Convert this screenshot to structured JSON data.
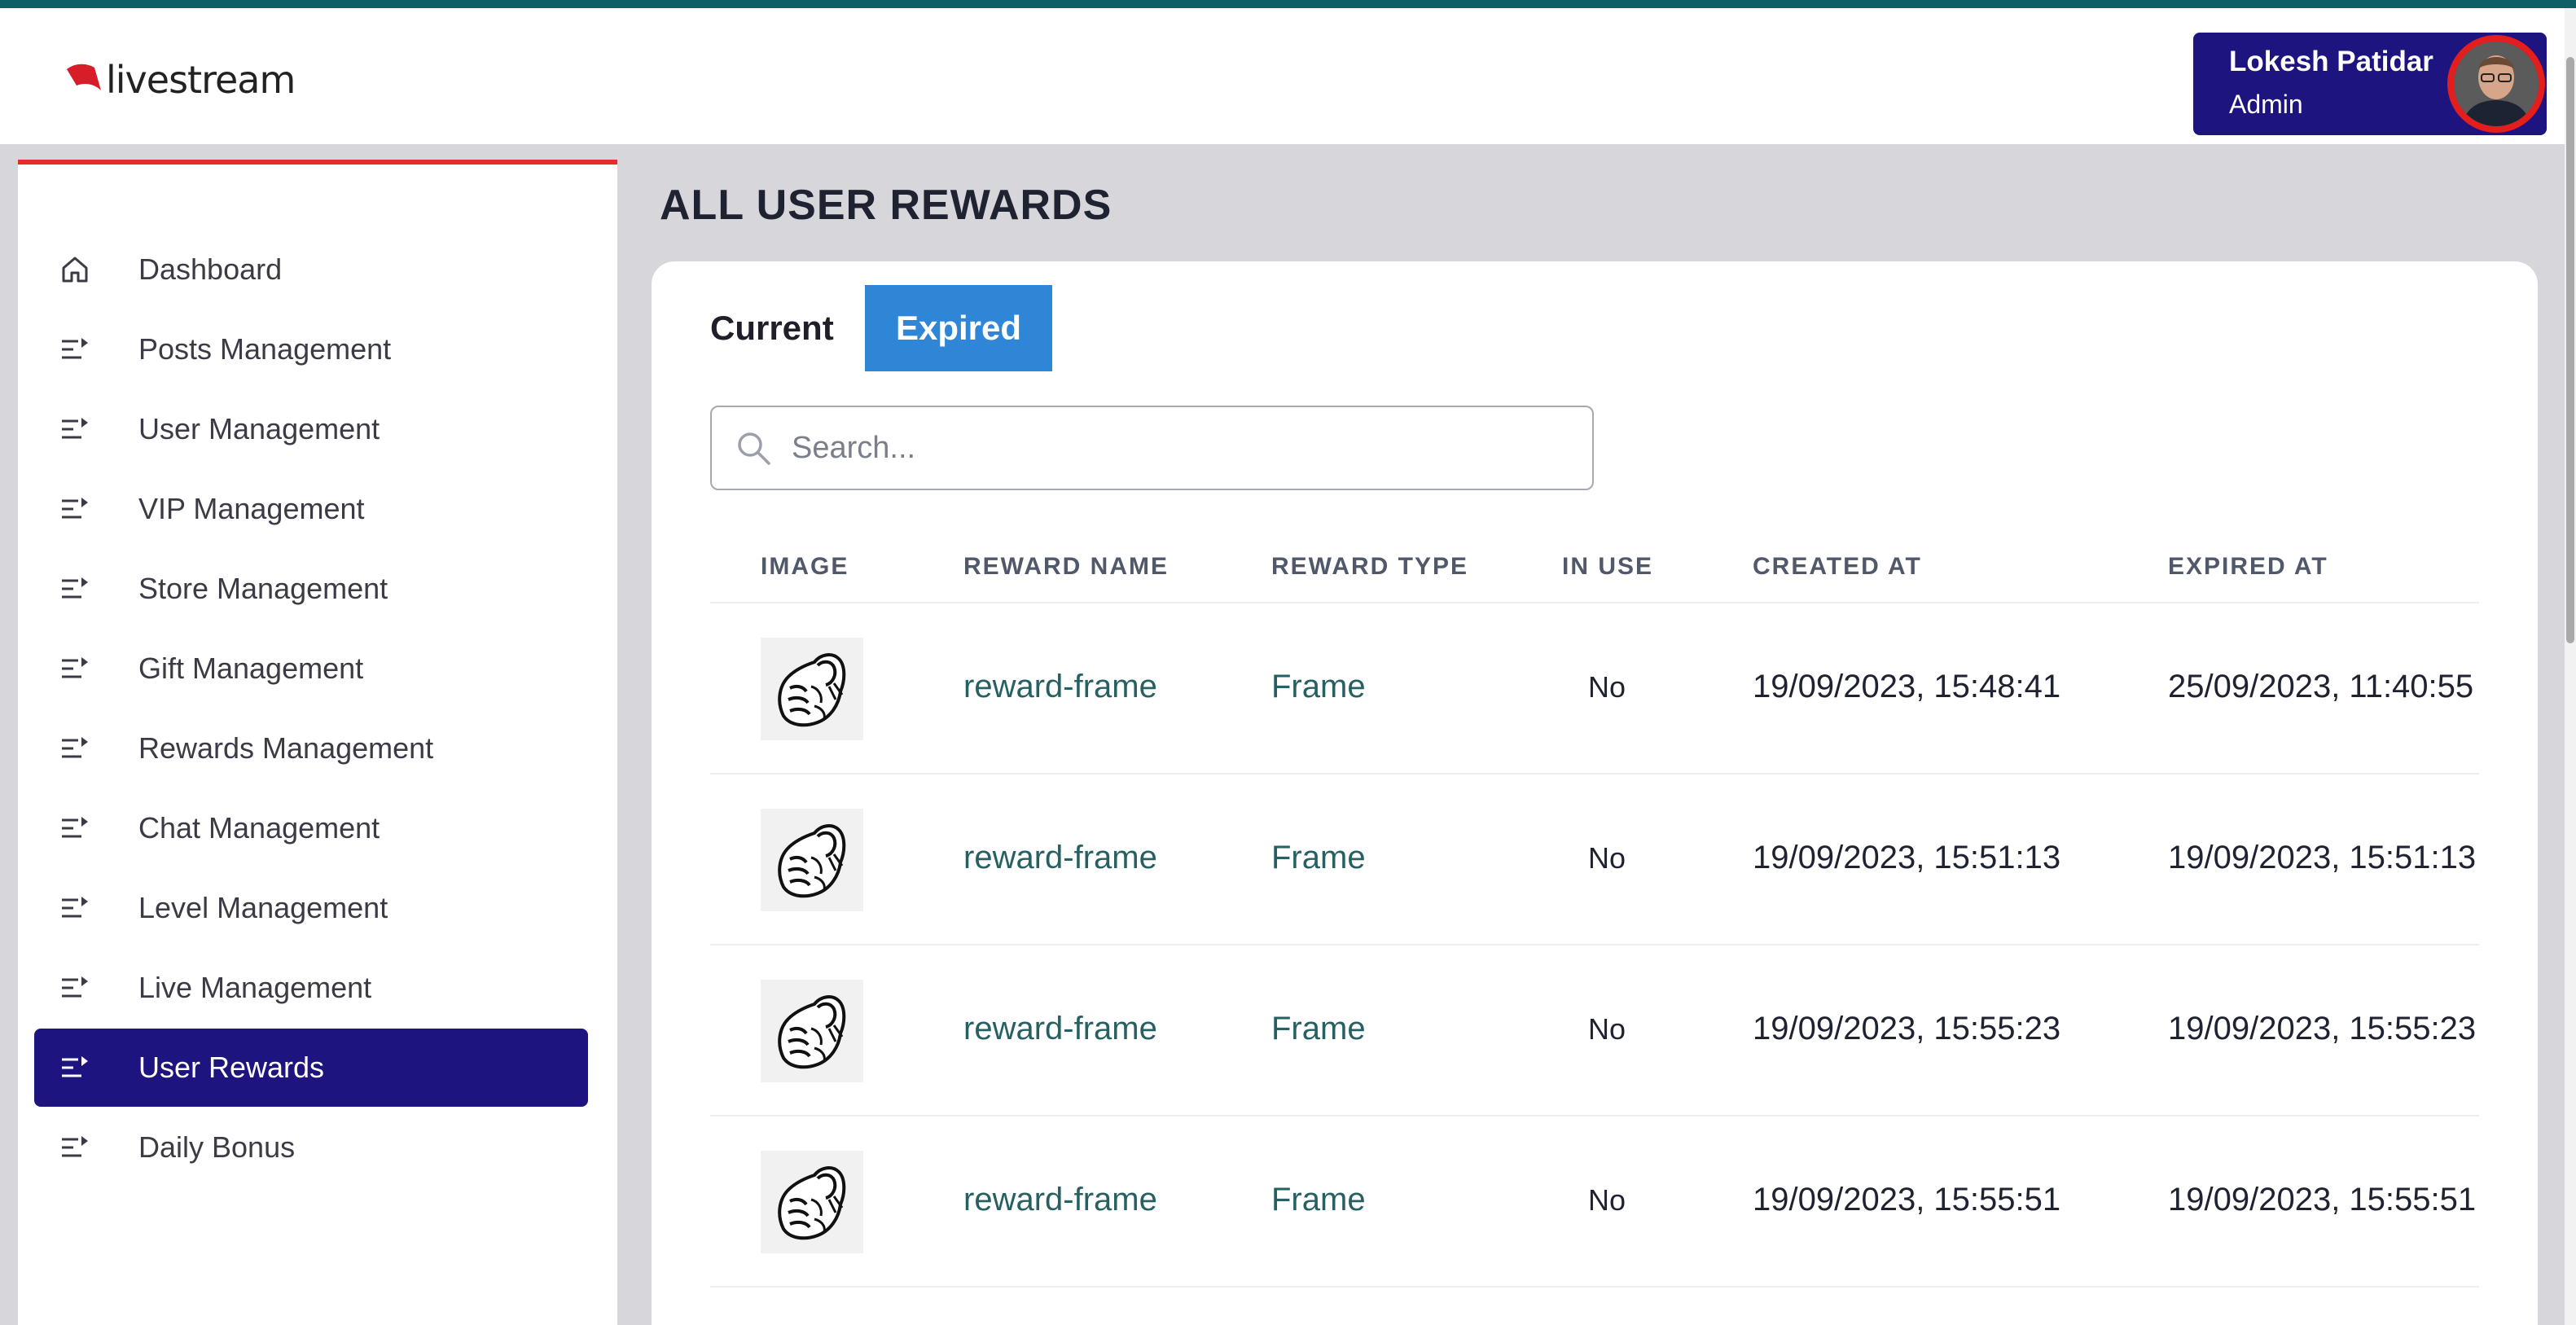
{
  "brand": {
    "logo_text": "livestream",
    "accent": "#e52b2b",
    "top_border": "#0e5f66"
  },
  "user": {
    "name": "Lokesh Patidar",
    "role": "Admin",
    "card_color": "#1e1480"
  },
  "sidebar": {
    "items": [
      {
        "label": "Dashboard",
        "icon": "home-icon",
        "active": false
      },
      {
        "label": "Posts Management",
        "icon": "list-arrow-icon",
        "active": false
      },
      {
        "label": "User Management",
        "icon": "list-arrow-icon",
        "active": false
      },
      {
        "label": "VIP Management",
        "icon": "list-arrow-icon",
        "active": false
      },
      {
        "label": "Store Management",
        "icon": "list-arrow-icon",
        "active": false
      },
      {
        "label": "Gift Management",
        "icon": "list-arrow-icon",
        "active": false
      },
      {
        "label": "Rewards Management",
        "icon": "list-arrow-icon",
        "active": false
      },
      {
        "label": "Chat Management",
        "icon": "list-arrow-icon",
        "active": false
      },
      {
        "label": "Level Management",
        "icon": "list-arrow-icon",
        "active": false
      },
      {
        "label": "Live Management",
        "icon": "list-arrow-icon",
        "active": false
      },
      {
        "label": "User Rewards",
        "icon": "list-arrow-icon",
        "active": true
      },
      {
        "label": "Daily Bonus",
        "icon": "list-arrow-icon",
        "active": false
      }
    ]
  },
  "page": {
    "title": "ALL USER REWARDS"
  },
  "tabs": {
    "current": "Current",
    "expired": "Expired",
    "selected": "Expired",
    "selected_color": "#2f86d6"
  },
  "search": {
    "placeholder": "Search...",
    "value": ""
  },
  "table": {
    "columns": [
      "IMAGE",
      "REWARD NAME",
      "REWARD TYPE",
      "IN USE",
      "CREATED AT",
      "EXPIRED AT"
    ],
    "rows": [
      {
        "reward_name": "reward-frame",
        "reward_type": "Frame",
        "in_use": "No",
        "created_at": "19/09/2023, 15:48:41",
        "expired_at": "25/09/2023, 11:40:55"
      },
      {
        "reward_name": "reward-frame",
        "reward_type": "Frame",
        "in_use": "No",
        "created_at": "19/09/2023, 15:51:13",
        "expired_at": "19/09/2023, 15:51:13"
      },
      {
        "reward_name": "reward-frame",
        "reward_type": "Frame",
        "in_use": "No",
        "created_at": "19/09/2023, 15:55:23",
        "expired_at": "19/09/2023, 15:55:23"
      },
      {
        "reward_name": "reward-frame",
        "reward_type": "Frame",
        "in_use": "No",
        "created_at": "19/09/2023, 15:55:51",
        "expired_at": "19/09/2023, 15:55:51"
      }
    ]
  }
}
